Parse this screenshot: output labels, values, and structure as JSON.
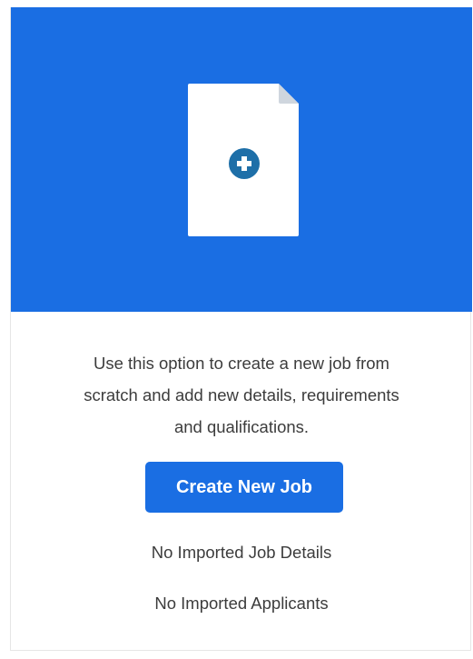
{
  "card": {
    "icon": "document-plus-icon",
    "description_lines": [
      "Use this option to create a new job from",
      "scratch and add new details, requirements",
      "and qualifications."
    ],
    "button_label": "Create New Job",
    "status_job_details": "No Imported Job Details",
    "status_applicants": "No Imported Applicants"
  },
  "colors": {
    "accent": "#1a6ee3",
    "icon_accent": "#1e6fa8",
    "text": "#3c3c3c"
  }
}
